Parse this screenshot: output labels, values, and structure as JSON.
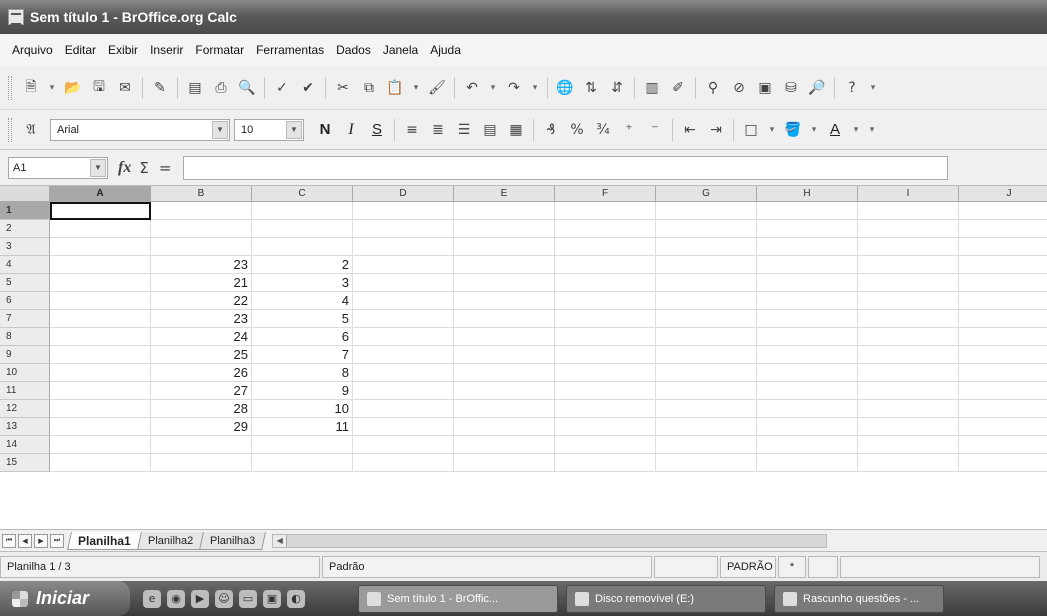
{
  "window": {
    "title": "Sem título 1 - BrOffice.org Calc"
  },
  "menu": [
    "Arquivo",
    "Editar",
    "Exibir",
    "Inserir",
    "Formatar",
    "Ferramentas",
    "Dados",
    "Janela",
    "Ajuda"
  ],
  "format_toolbar": {
    "font_name": "Arial",
    "font_size": "10",
    "bold": "N",
    "italic": "I",
    "underline": "S"
  },
  "formula_bar": {
    "name_box": "A1",
    "content": ""
  },
  "columns": [
    "A",
    "B",
    "C",
    "D",
    "E",
    "F",
    "G",
    "H",
    "I",
    "J"
  ],
  "rows": [
    "1",
    "2",
    "3",
    "4",
    "5",
    "6",
    "7",
    "8",
    "9",
    "10",
    "11",
    "12",
    "13",
    "14",
    "15"
  ],
  "cells": [
    {
      "ref": "B4",
      "value": "23"
    },
    {
      "ref": "C4",
      "value": "2"
    },
    {
      "ref": "B5",
      "value": "21"
    },
    {
      "ref": "C5",
      "value": "3"
    },
    {
      "ref": "B6",
      "value": "22"
    },
    {
      "ref": "C6",
      "value": "4"
    },
    {
      "ref": "B7",
      "value": "23"
    },
    {
      "ref": "C7",
      "value": "5"
    },
    {
      "ref": "B8",
      "value": "24"
    },
    {
      "ref": "C8",
      "value": "6"
    },
    {
      "ref": "B9",
      "value": "25"
    },
    {
      "ref": "C9",
      "value": "7"
    },
    {
      "ref": "B10",
      "value": "26"
    },
    {
      "ref": "C10",
      "value": "8"
    },
    {
      "ref": "B11",
      "value": "27"
    },
    {
      "ref": "C11",
      "value": "9"
    },
    {
      "ref": "B12",
      "value": "28"
    },
    {
      "ref": "C12",
      "value": "10"
    },
    {
      "ref": "B13",
      "value": "29"
    },
    {
      "ref": "C13",
      "value": "11"
    }
  ],
  "selected_cell": "A1",
  "sheets": [
    {
      "name": "Planilha1",
      "active": true
    },
    {
      "name": "Planilha2",
      "active": false
    },
    {
      "name": "Planilha3",
      "active": false
    }
  ],
  "status": {
    "sheet_position": "Planilha 1 / 3",
    "page_style": "Padrão",
    "mode": "PADRÃO",
    "modified": "*"
  },
  "taskbar": {
    "start_label": "Iniciar",
    "tasks": [
      "Sem título 1 - BrOffic...",
      "Disco removível (E:)",
      "Rascunho questões - ..."
    ]
  }
}
